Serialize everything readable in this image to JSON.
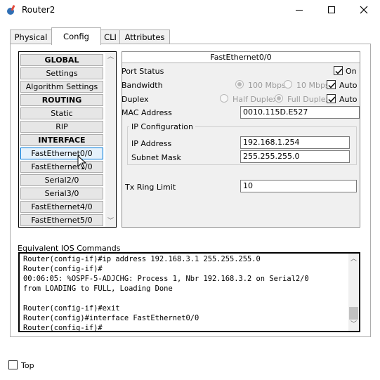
{
  "window": {
    "title": "Router2"
  },
  "tabs": [
    {
      "label": "Physical"
    },
    {
      "label": "Config"
    },
    {
      "label": "CLI"
    },
    {
      "label": "Attributes"
    }
  ],
  "sidebar": {
    "items": [
      {
        "label": "GLOBAL"
      },
      {
        "label": "Settings"
      },
      {
        "label": "Algorithm Settings"
      },
      {
        "label": "ROUTING"
      },
      {
        "label": "Static"
      },
      {
        "label": "RIP"
      },
      {
        "label": "INTERFACE"
      },
      {
        "label": "FastEthernet0/0"
      },
      {
        "label": "FastEthernet1/0"
      },
      {
        "label": "Serial2/0"
      },
      {
        "label": "Serial3/0"
      },
      {
        "label": "FastEthernet4/0"
      },
      {
        "label": "FastEthernet5/0"
      }
    ]
  },
  "interface": {
    "title": "FastEthernet0/0",
    "port_status_label": "Port Status",
    "port_status_on_label": "On",
    "bandwidth_label": "Bandwidth",
    "bw_100": "100 Mbps",
    "bw_10": "10 Mbps",
    "bw_auto": "Auto",
    "duplex_label": "Duplex",
    "half_duplex": "Half Duplex",
    "full_duplex": "Full Duplex",
    "duplex_auto": "Auto",
    "mac_label": "MAC Address",
    "mac_value": "0010.115D.E527",
    "ip_config_label": "IP Configuration",
    "ip_label": "IP Address",
    "ip_value": "192.168.1.254",
    "mask_label": "Subnet Mask",
    "mask_value": "255.255.255.0",
    "tx_label": "Tx Ring Limit",
    "tx_value": "10"
  },
  "ios": {
    "label": "Equivalent IOS Commands",
    "lines": [
      "Router(config-if)#ip address 192.168.3.1 255.255.255.0",
      "Router(config-if)#",
      "00:06:05: %OSPF-5-ADJCHG: Process 1, Nbr 192.168.3.2 on Serial2/0",
      "from LOADING to FULL, Loading Done",
      "",
      "Router(config-if)#exit",
      "Router(config)#interface FastEthernet0/0",
      "Router(config-if)#"
    ]
  },
  "footer": {
    "top_label": "Top"
  }
}
